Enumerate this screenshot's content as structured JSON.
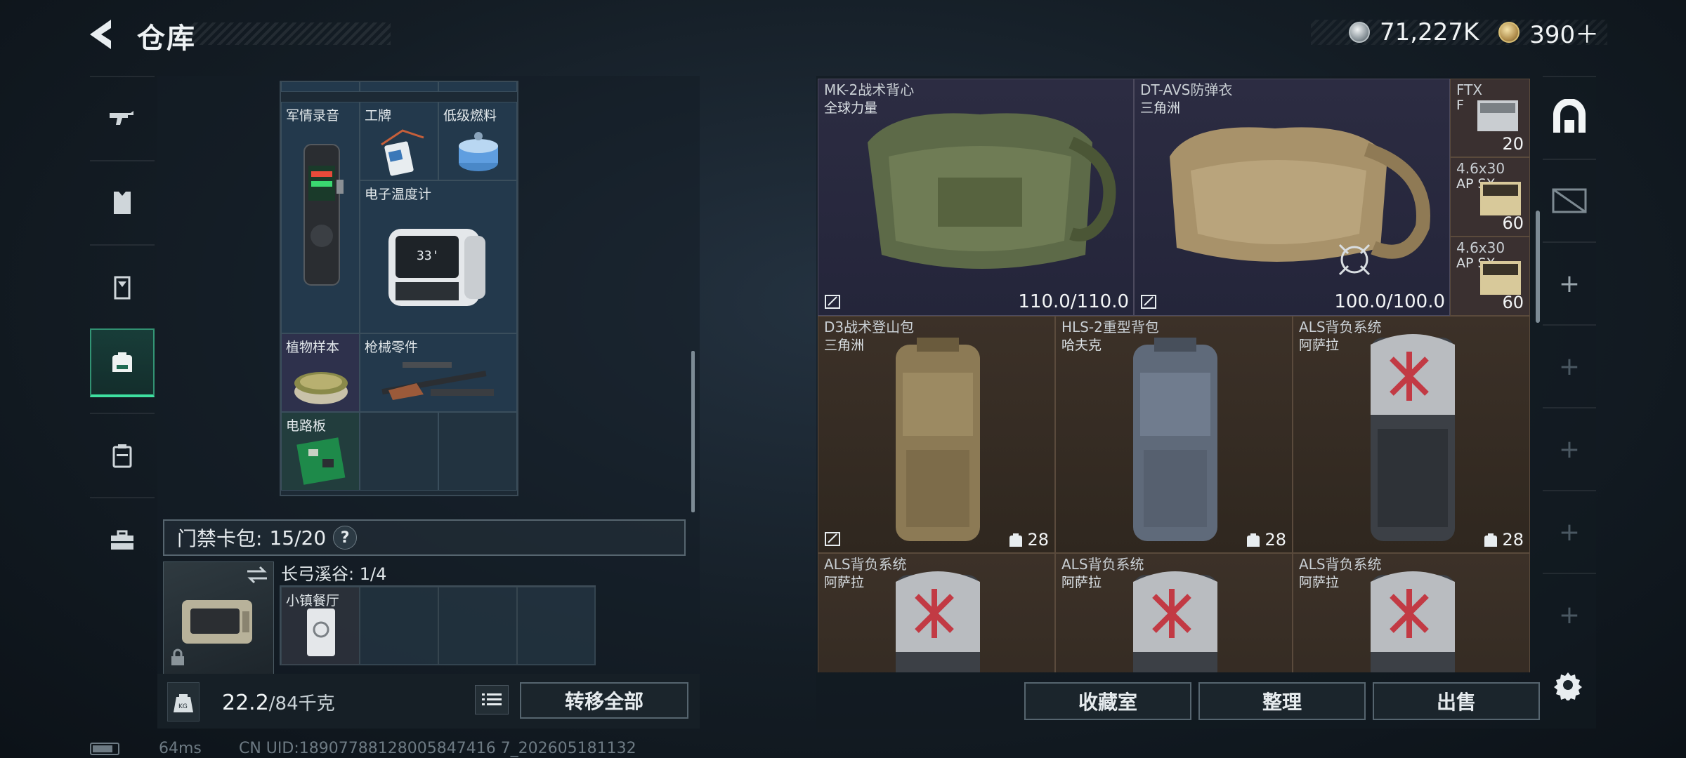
{
  "header": {
    "title": "仓库"
  },
  "currency": {
    "silver": "71,227K",
    "gold": "390＋"
  },
  "left_tabs": [
    "rifle-icon",
    "vest-icon",
    "chest-rig-icon",
    "backpack-icon",
    "case-icon",
    "toolbox-icon"
  ],
  "grid_items": [
    {
      "name": "军情录音"
    },
    {
      "name": "工牌"
    },
    {
      "name": "低级燃料"
    },
    {
      "name": "电子温度计"
    },
    {
      "name": "植物样本"
    },
    {
      "name": "枪械零件"
    },
    {
      "name": "电路板"
    }
  ],
  "card_pack": {
    "label": "门禁卡包:",
    "value": "15/20",
    "help": "?"
  },
  "keycase": {
    "map": "长弓溪谷:",
    "count": "1/4",
    "card_name": "小镇餐厅"
  },
  "weight": {
    "current": "22.2",
    "max": "/84千克"
  },
  "transfer_all": "转移全部",
  "status": {
    "ping": "64ms",
    "uid": "CN UID:18907788128005847416 7_202605181132"
  },
  "storage": {
    "armor": [
      {
        "name": "MK-2战术背心",
        "brand": "全球力量",
        "durability": "110.0/110.0"
      },
      {
        "name": "DT-AVS防弹衣",
        "brand": "三角洲",
        "durability": "100.0/100.0"
      }
    ],
    "ammo": [
      {
        "name": "FTX",
        "name2": "F",
        "count": "20"
      },
      {
        "name": "4.6x30",
        "name2": "AP SX",
        "count": "60"
      },
      {
        "name": "4.6x30",
        "name2": "AP SX",
        "count": "60"
      }
    ],
    "bags": [
      {
        "name": "D3战术登山包",
        "brand": "三角洲",
        "capacity": "28"
      },
      {
        "name": "HLS-2重型背包",
        "brand": "哈夫克",
        "capacity": "28"
      },
      {
        "name": "ALS背负系统",
        "brand": "阿萨拉",
        "capacity": "28"
      },
      {
        "name": "ALS背负系统",
        "brand": "阿萨拉",
        "capacity": ""
      },
      {
        "name": "ALS背负系统",
        "brand": "阿萨拉",
        "capacity": ""
      },
      {
        "name": "ALS背负系统",
        "brand": "阿萨拉",
        "capacity": ""
      }
    ]
  },
  "actions": {
    "collection": "收藏室",
    "organize": "整理",
    "sell": "出售"
  }
}
